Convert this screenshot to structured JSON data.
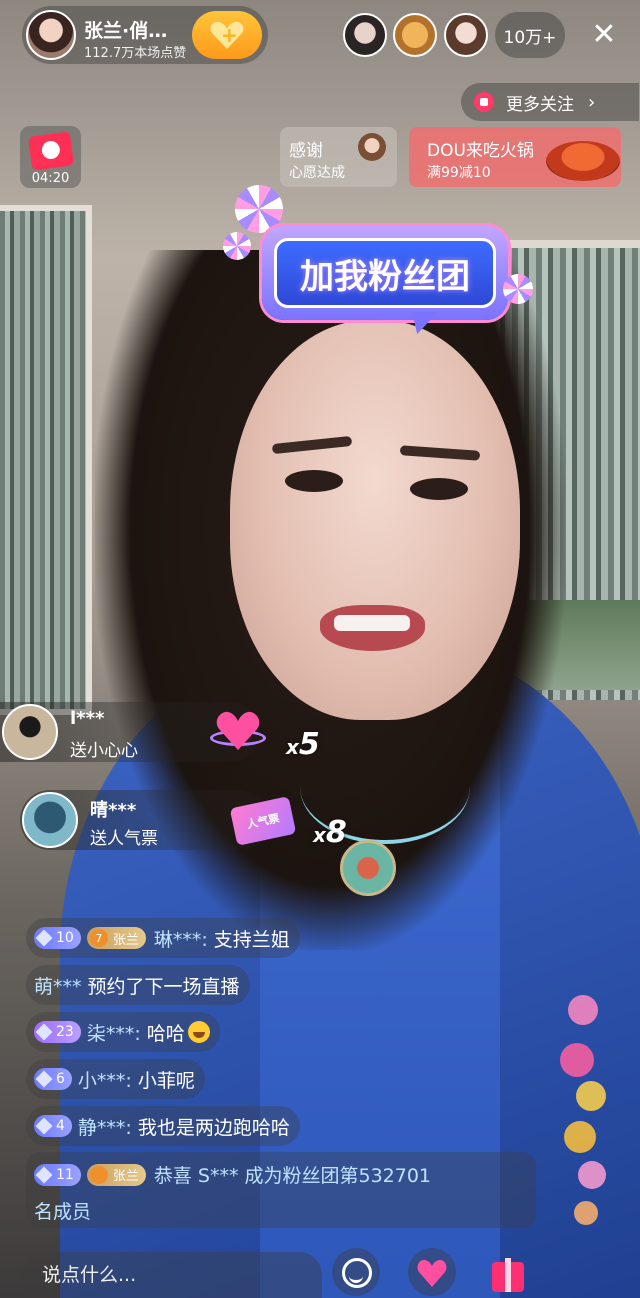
{
  "host": {
    "name": "张兰·俏…",
    "likes": "112.7万本场点赞"
  },
  "viewers": {
    "count": "10万+"
  },
  "top_actions": {
    "more_follow_label": "更多关注",
    "chevron": "›",
    "close_glyph": "✕"
  },
  "promos": {
    "timer": "04:20",
    "thanks_title": "感谢",
    "thanks_subtitle": "心愿达成",
    "dou_title": "DOU来吃火锅",
    "dou_subtitle": "满99减10"
  },
  "sticker": {
    "text": "加我粉丝团"
  },
  "gifts": [
    {
      "user": "l***",
      "text": "送小心心",
      "combo_x": "x",
      "combo_n": "5"
    },
    {
      "user": "晴***",
      "text": "送人气票",
      "combo_x": "x",
      "combo_n": "8",
      "ticket_label": "人气票"
    }
  ],
  "chat": [
    {
      "level": "10",
      "fan_level": "7",
      "fan_name": "张兰",
      "user": "琳***:",
      "text": "支持兰姐"
    },
    {
      "user": "萌***",
      "text": "预约了下一场直播"
    },
    {
      "level": "23",
      "user": "柒***:",
      "text": "哈哈"
    },
    {
      "level": "6",
      "user": "小***:",
      "text": "小菲呢"
    },
    {
      "level": "4",
      "user": "静***:",
      "text": "我也是两边跑哈哈"
    },
    {
      "level": "11",
      "fan_level": "",
      "fan_name": "张兰",
      "text_line1": "恭喜 S*** 成为粉丝团第532701",
      "text_line2": "名成员"
    }
  ],
  "bottom": {
    "input_placeholder": "说点什么..."
  },
  "colors": {
    "accent_pink": "#ff4fa1",
    "fan_orange": "#ff9a1a",
    "promo_red": "#ee6e6e"
  }
}
